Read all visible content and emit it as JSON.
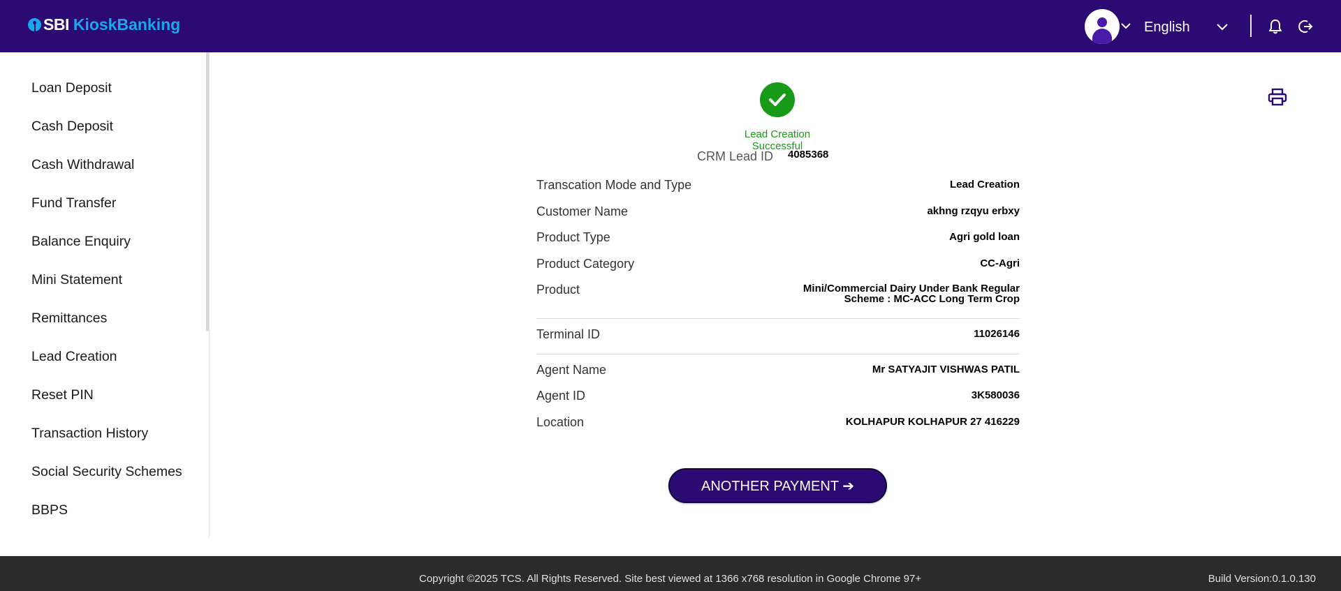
{
  "header": {
    "logo_sbi": "SBI",
    "logo_kiosk": "KioskBanking",
    "language": "English",
    "colors": {
      "header_bg": "#2c0a73",
      "logo_accent": "#1aa8e8"
    },
    "icons": [
      "user-avatar-icon",
      "chevron-down-icon",
      "bell-icon",
      "logout-icon"
    ]
  },
  "sidebar": {
    "items": [
      {
        "label": "Loan Deposit"
      },
      {
        "label": "Cash Deposit"
      },
      {
        "label": "Cash Withdrawal"
      },
      {
        "label": "Fund Transfer"
      },
      {
        "label": "Balance Enquiry"
      },
      {
        "label": "Mini Statement"
      },
      {
        "label": "Remittances"
      },
      {
        "label": "Lead Creation"
      },
      {
        "label": "Reset PIN"
      },
      {
        "label": "Transaction History"
      },
      {
        "label": "Social Security Schemes"
      },
      {
        "label": "BBPS"
      }
    ]
  },
  "receipt": {
    "status_text": "Lead Creation Successful",
    "status_color": "#179a16",
    "crm_label": "CRM Lead ID",
    "crm_value": "4085368",
    "rows": [
      {
        "label": "Transcation Mode and Type",
        "value": "Lead Creation"
      },
      {
        "label": "Customer Name",
        "value": "akhng rzqyu erbxy"
      },
      {
        "label": "Product Type",
        "value": "Agri gold loan"
      },
      {
        "label": "Product Category",
        "value": "CC-Agri"
      },
      {
        "label": "Product",
        "value": "Mini/Commercial Dairy Under Bank Regular Scheme : MC-ACC Long Term Crop"
      },
      {
        "label": "Terminal ID",
        "value": "11026146"
      },
      {
        "label": "Agent Name",
        "value": "Mr SATYAJIT VISHWAS PATIL"
      },
      {
        "label": "Agent ID",
        "value": "3K580036"
      },
      {
        "label": "Location",
        "value": "KOLHAPUR KOLHAPUR 27 416229"
      }
    ],
    "another_payment_label": "ANOTHER PAYMENT ➔"
  },
  "footer": {
    "copyright": "Copyright ©2025 TCS. All Rights Reserved. Site best viewed at 1366 x768 resolution in Google Chrome 97+",
    "build": "Build Version:0.1.0.130"
  }
}
